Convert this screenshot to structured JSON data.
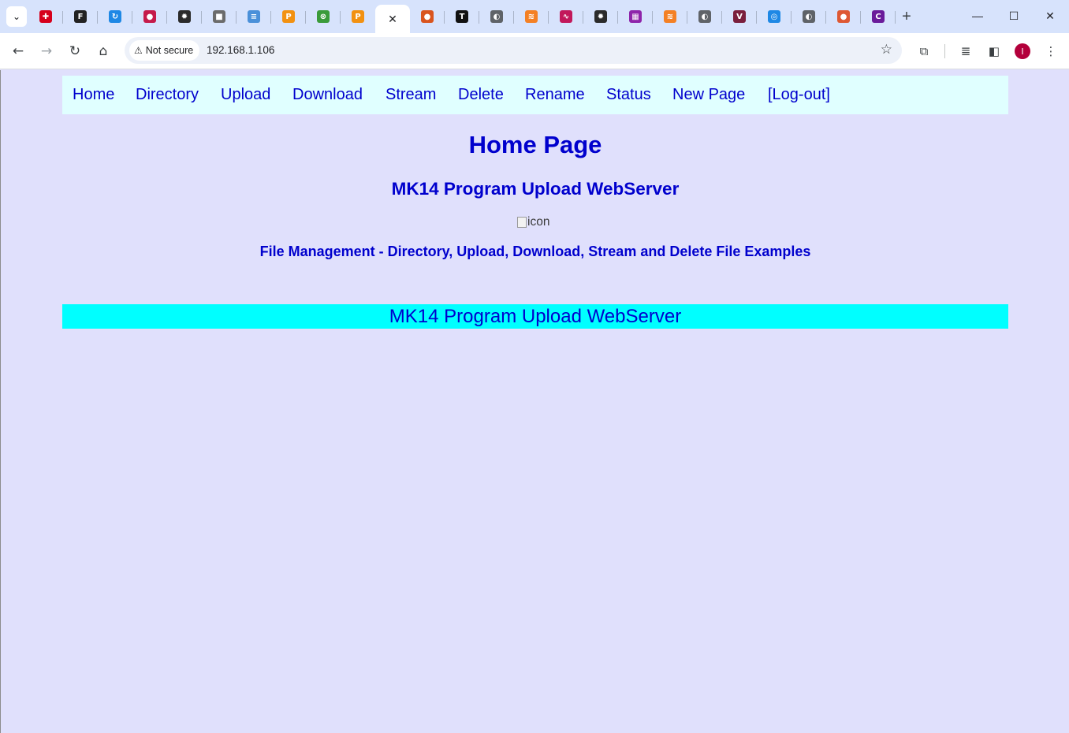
{
  "browser": {
    "tabs": [
      {
        "icon": "red-puzzle-icon",
        "color": "#d6001c",
        "glyph": "✚"
      },
      {
        "icon": "f-logo-icon",
        "color": "#222222",
        "glyph": "F"
      },
      {
        "icon": "refresh-blue-icon",
        "color": "#1e88e5",
        "glyph": "↻"
      },
      {
        "icon": "raspberry-icon",
        "color": "#c51a4a",
        "glyph": "●"
      },
      {
        "icon": "gear-dark-icon",
        "color": "#2b2b2b",
        "glyph": "✹"
      },
      {
        "icon": "grey-box-icon",
        "color": "#6b6b6b",
        "glyph": "■"
      },
      {
        "icon": "document-icon",
        "color": "#4a90d9",
        "glyph": "≡"
      },
      {
        "icon": "phpmyadmin-icon",
        "color": "#f29111",
        "glyph": "P"
      },
      {
        "icon": "green-circle-icon",
        "color": "#3a9b3a",
        "glyph": "⊗"
      },
      {
        "icon": "phpmyadmin-icon",
        "color": "#f29111",
        "glyph": "P"
      },
      {
        "icon": "close-icon",
        "active": true,
        "glyph": "✕"
      },
      {
        "icon": "balloon-icon",
        "color": "#d9541e",
        "glyph": "●"
      },
      {
        "icon": "tes-icon",
        "color": "#111111",
        "glyph": "T"
      },
      {
        "icon": "globe-icon",
        "color": "#5f6368",
        "glyph": "◐"
      },
      {
        "icon": "stackoverflow-icon",
        "color": "#f48024",
        "glyph": "≋"
      },
      {
        "icon": "wave-icon",
        "color": "#c2185b",
        "glyph": "∿"
      },
      {
        "icon": "gear-dark-icon",
        "color": "#2b2b2b",
        "glyph": "✹"
      },
      {
        "icon": "grid-app-icon",
        "color": "#8e24aa",
        "glyph": "▦"
      },
      {
        "icon": "stackoverflow-icon",
        "color": "#f48024",
        "glyph": "≋"
      },
      {
        "icon": "globe-icon",
        "color": "#5f6368",
        "glyph": "◐"
      },
      {
        "icon": "v-logo-icon",
        "color": "#7a1f3d",
        "glyph": "V"
      },
      {
        "icon": "chat-icon",
        "color": "#1e88e5",
        "glyph": "◎"
      },
      {
        "icon": "globe-icon",
        "color": "#5f6368",
        "glyph": "◐"
      },
      {
        "icon": "duckduckgo-icon",
        "color": "#de5833",
        "glyph": "●"
      },
      {
        "icon": "c-logo-icon",
        "color": "#6a1b9a",
        "glyph": "C"
      }
    ],
    "security_label": "Not secure",
    "url": "192.168.1.106",
    "profile_initial": "I"
  },
  "nav": {
    "items": [
      "Home",
      "Directory",
      "Upload",
      "Download",
      "Stream",
      "Delete",
      "Rename",
      "Status",
      "New Page",
      "[Log-out]"
    ]
  },
  "page": {
    "title": "Home Page",
    "subtitle": "MK14 Program Upload WebServer",
    "image_alt": "icon",
    "description": "File Management - Directory, Upload, Download, Stream and Delete File Examples",
    "footer": "MK14 Program Upload WebServer"
  },
  "colors": {
    "page_bg": "#e0e0fc",
    "nav_bg": "#e0ffff",
    "footer_bg": "#00ffff",
    "text": "#0000cd"
  }
}
